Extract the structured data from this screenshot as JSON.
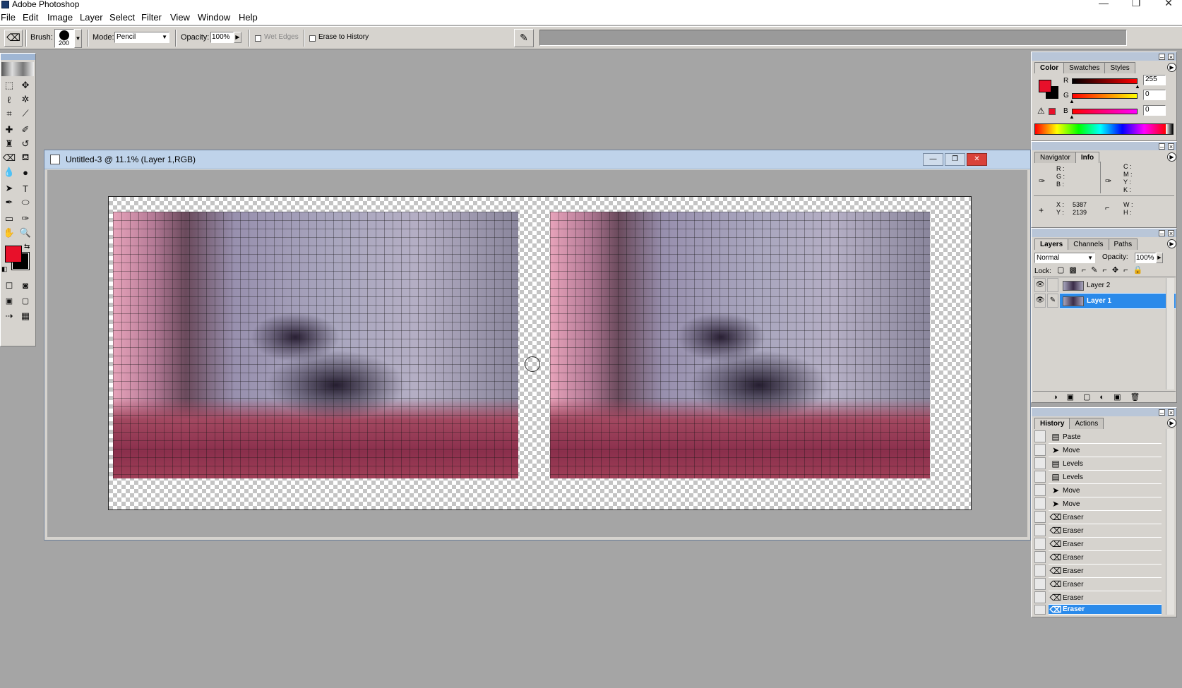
{
  "app": {
    "title": "Adobe Photoshop"
  },
  "window_controls": {
    "minimize": "—",
    "restore": "❐",
    "close": "✕"
  },
  "menu": [
    "File",
    "Edit",
    "Image",
    "Layer",
    "Select",
    "Filter",
    "View",
    "Window",
    "Help"
  ],
  "options": {
    "brush_label": "Brush:",
    "brush_size": "200",
    "mode_label": "Mode:",
    "mode_value": "Pencil",
    "opacity_label": "Opacity:",
    "opacity_value": "100%",
    "wet_edges": "Wet Edges",
    "erase_to_history": "Erase to History"
  },
  "document": {
    "title": "Untitled-3 @ 11.1% (Layer 1,RGB)"
  },
  "color_panel": {
    "tabs": [
      "Color",
      "Swatches",
      "Styles"
    ],
    "r_label": "R",
    "r_value": "255",
    "r_level": 1.0,
    "g_label": "G",
    "g_value": "0",
    "g_level": 0.0,
    "b_label": "B",
    "b_value": "0",
    "b_level": 0.0,
    "foreground": "#e8102a",
    "background": "#000000"
  },
  "info_panel": {
    "tabs": [
      "Navigator",
      "Info"
    ],
    "rgb_labels": "R :\nG :\nB :",
    "cmyk_labels": "C :\nM :\nY :\nK :",
    "xy_labels": "X :\nY :",
    "x_value": "5387",
    "y_value": "2139",
    "wh_labels": "W :\nH :"
  },
  "layers_panel": {
    "tabs": [
      "Layers",
      "Channels",
      "Paths"
    ],
    "blend_mode": "Normal",
    "opacity_label": "Opacity:",
    "opacity_value": "100%",
    "lock_label": "Lock:",
    "layers": [
      {
        "name": "Layer 2",
        "selected": false
      },
      {
        "name": "Layer 1",
        "selected": true
      }
    ]
  },
  "history_panel": {
    "tabs": [
      "History",
      "Actions"
    ],
    "items": [
      {
        "name": "Paste",
        "icon": "paste-icon"
      },
      {
        "name": "Move",
        "icon": "move-icon"
      },
      {
        "name": "Levels",
        "icon": "levels-icon"
      },
      {
        "name": "Levels",
        "icon": "levels-icon"
      },
      {
        "name": "Move",
        "icon": "move-icon"
      },
      {
        "name": "Move",
        "icon": "move-icon"
      },
      {
        "name": "Eraser",
        "icon": "eraser-icon"
      },
      {
        "name": "Eraser",
        "icon": "eraser-icon"
      },
      {
        "name": "Eraser",
        "icon": "eraser-icon"
      },
      {
        "name": "Eraser",
        "icon": "eraser-icon"
      },
      {
        "name": "Eraser",
        "icon": "eraser-icon"
      },
      {
        "name": "Eraser",
        "icon": "eraser-icon"
      },
      {
        "name": "Eraser",
        "icon": "eraser-icon"
      },
      {
        "name": "Eraser",
        "icon": "eraser-icon"
      }
    ]
  },
  "colors": {
    "accent": "#2a8aea",
    "panel": "#d6d3ce",
    "workspace": "#a5a5a5"
  }
}
